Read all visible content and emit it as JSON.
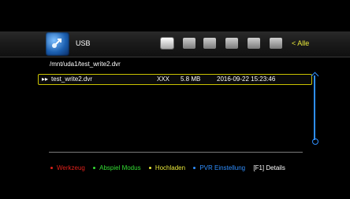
{
  "header": {
    "title": "USB",
    "filter_label": "< Alle",
    "tabs": [
      {
        "icon": "folder-icon"
      },
      {
        "icon": "hdd-icon"
      },
      {
        "icon": "tv-icon"
      },
      {
        "icon": "picture-icon"
      },
      {
        "icon": "film-icon"
      },
      {
        "icon": "music-icon"
      }
    ]
  },
  "path": "/mnt/uda1/test_write2.dvr",
  "files": [
    {
      "marker": "▸▸",
      "name": "test_write2.dvr",
      "type": "XXX",
      "size": "5.8 MB",
      "date": "2016-09-22 15:23:46"
    }
  ],
  "footer": {
    "red": "Werkzeug",
    "green": "Abspiel Modus",
    "yellow": "Hochladen",
    "blue": "PVR Einstellung",
    "f1_key": "[F1]",
    "f1_label": "Details"
  },
  "colors": {
    "red": "#e0201a",
    "green": "#33dd33",
    "yellow": "#e8e83a",
    "blue": "#2f8fff",
    "highlight_border": "#c9c200"
  }
}
